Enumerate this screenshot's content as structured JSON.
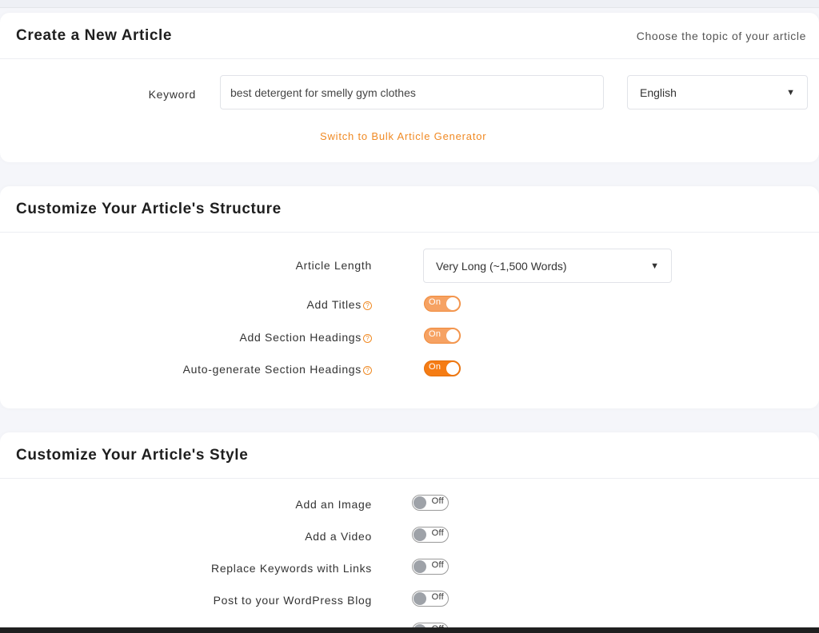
{
  "create": {
    "title": "Create a New Article",
    "subtitle": "Choose the topic of your article",
    "keyword_label": "Keyword",
    "keyword_value": "best detergent for smelly gym clothes",
    "language_value": "English",
    "bulk_link": "Switch to Bulk Article Generator"
  },
  "structure": {
    "title": "Customize Your Article's Structure",
    "length_label": "Article Length",
    "length_value": "Very Long (~1,500 Words)",
    "options": [
      {
        "label": "Add Titles",
        "state": "On"
      },
      {
        "label": "Add Section Headings",
        "state": "On"
      },
      {
        "label": "Auto-generate Section Headings",
        "state": "On"
      }
    ]
  },
  "style": {
    "title": "Customize Your Article's Style",
    "options": [
      {
        "label": "Add an Image",
        "state": "Off"
      },
      {
        "label": "Add a Video",
        "state": "Off"
      },
      {
        "label": "Replace Keywords with Links",
        "state": "Off"
      },
      {
        "label": "Post to your WordPress Blog",
        "state": "Off"
      },
      {
        "label": "",
        "state": "Off"
      }
    ]
  },
  "icons": {
    "help": "?",
    "chevron": "⌄"
  },
  "colors": {
    "accent": "#f08a24",
    "toggle_on": "#f6a263",
    "toggle_on_strong": "#f57c14",
    "toggle_off_knob": "#9ea2a8"
  }
}
